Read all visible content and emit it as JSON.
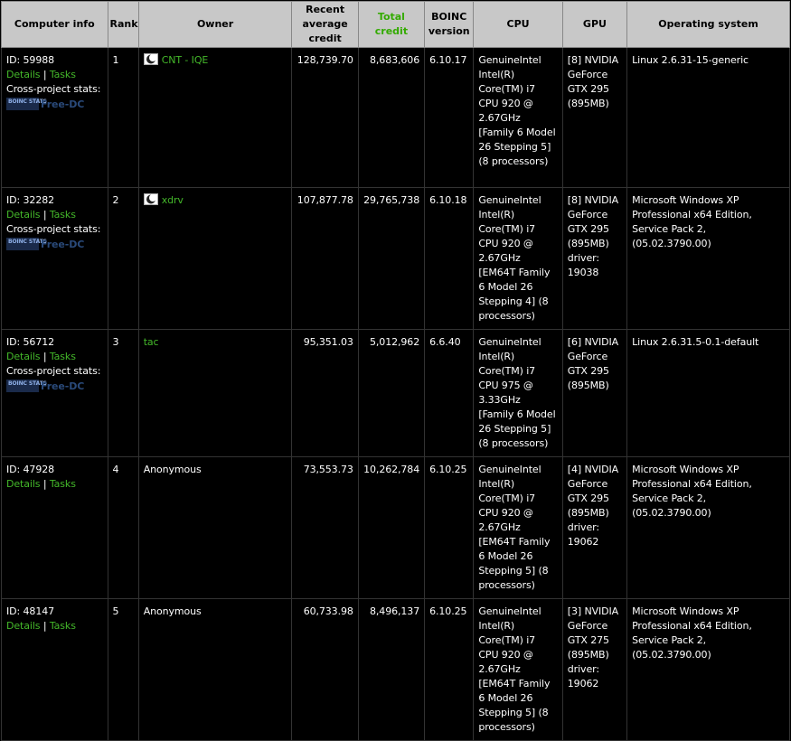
{
  "headers": {
    "computer_info": "Computer info",
    "rank": "Rank",
    "owner": "Owner",
    "recent_avg": "Recent average credit",
    "total_credit": "Total credit",
    "boinc_version": "BOINC version",
    "cpu": "CPU",
    "gpu": "GPU",
    "os": "Operating system"
  },
  "links": {
    "details": "Details",
    "tasks": "Tasks",
    "separator": "|",
    "cross_project": "Cross-project stats:"
  },
  "stats_logos": {
    "boincstats": "BOINC STATS",
    "free_dc": "Free-DC"
  },
  "colors": {
    "link": "#44b82a",
    "header_bg": "#c8c8c8",
    "sorted_header": "#33aa00",
    "background": "#000000"
  },
  "rows": [
    {
      "id": "ID: 59988",
      "rank": "1",
      "owner": "CNT - IQE",
      "owner_linked": true,
      "recent_avg": "128,739.70",
      "total": "8,683,606",
      "version": "6.10.17",
      "cpu": "GenuineIntel Intel(R) Core(TM) i7 CPU 920 @ 2.67GHz [Family 6 Model 26 Stepping 5] (8 processors)",
      "gpu": "[8] NVIDIA GeForce GTX 295 (895MB)",
      "os": "Linux 2.6.31-15-generic"
    },
    {
      "id": "ID: 32282",
      "rank": "2",
      "owner": "xdrv",
      "owner_linked": true,
      "recent_avg": "107,877.78",
      "total": "29,765,738",
      "version": "6.10.18",
      "cpu": "GenuineIntel Intel(R) Core(TM) i7 CPU 920 @ 2.67GHz [EM64T Family 6 Model 26 Stepping 4] (8 processors)",
      "gpu": "[8] NVIDIA GeForce GTX 295 (895MB) driver: 19038",
      "os": "Microsoft Windows XP Professional x64 Edition, Service Pack 2, (05.02.3790.00)"
    },
    {
      "id": "ID: 56712",
      "rank": "3",
      "owner": "tac",
      "owner_linked": true,
      "recent_avg": "95,351.03",
      "total": "5,012,962",
      "version": "6.6.40",
      "cpu": "GenuineIntel Intel(R) Core(TM) i7 CPU 975 @ 3.33GHz [Family 6 Model 26 Stepping 5] (8 processors)",
      "gpu": "[6] NVIDIA GeForce GTX 295 (895MB)",
      "os": "Linux 2.6.31.5-0.1-default"
    },
    {
      "id": "ID: 47928",
      "rank": "4",
      "owner": "Anonymous",
      "owner_linked": false,
      "recent_avg": "73,553.73",
      "total": "10,262,784",
      "version": "6.10.25",
      "cpu": "GenuineIntel Intel(R) Core(TM) i7 CPU 920 @ 2.67GHz [EM64T Family 6 Model 26 Stepping 5] (8 processors)",
      "gpu": "[4] NVIDIA GeForce GTX 295 (895MB) driver: 19062",
      "os": "Microsoft Windows XP Professional x64 Edition, Service Pack 2, (05.02.3790.00)"
    },
    {
      "id": "ID: 48147",
      "rank": "5",
      "owner": "Anonymous",
      "owner_linked": false,
      "recent_avg": "60,733.98",
      "total": "8,496,137",
      "version": "6.10.25",
      "cpu": "GenuineIntel Intel(R) Core(TM) i7 CPU 920 @ 2.67GHz [EM64T Family 6 Model 26 Stepping 5] (8 processors)",
      "gpu": "[3] NVIDIA GeForce GTX 275 (895MB) driver: 19062",
      "os": "Microsoft Windows XP Professional x64 Edition, Service Pack 2, (05.02.3790.00)"
    }
  ]
}
